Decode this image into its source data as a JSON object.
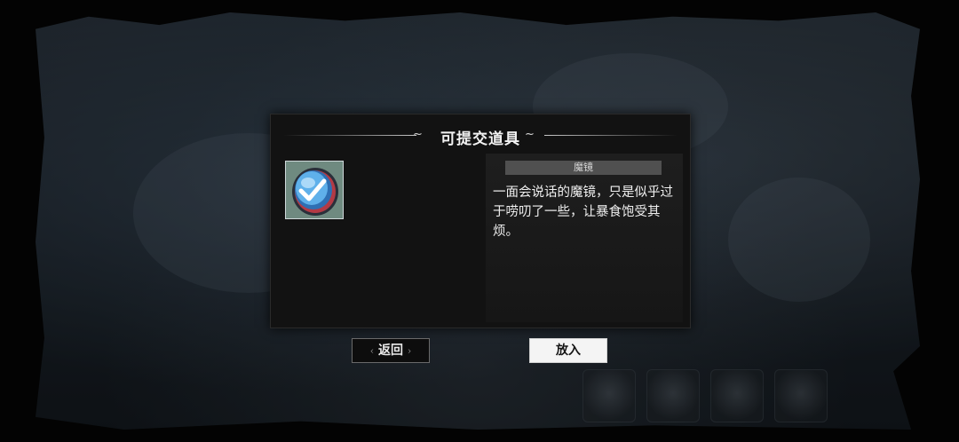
{
  "dialog": {
    "title": "可提交道具",
    "title_left_ornament": "~",
    "title_right_ornament": "~"
  },
  "item": {
    "icon": "magic-mirror-icon",
    "name": "魔镜",
    "description": "一面会说话的魔镜，只是似乎过于唠叨了一些，让暴食饱受其烦。"
  },
  "buttons": {
    "back_label": "返回",
    "put_label": "放入"
  },
  "colors": {
    "dialog_bg": "#121212",
    "accent_blue": "#4aa0e0",
    "put_button_bg": "#f4f4f4"
  }
}
